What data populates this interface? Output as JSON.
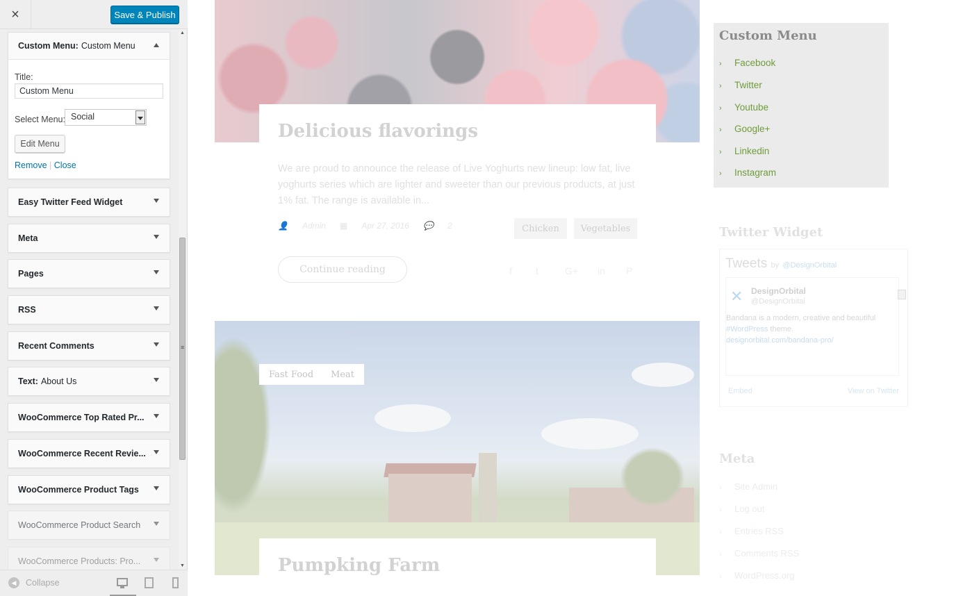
{
  "sidebar": {
    "close_label": "×",
    "publish_label": "Save & Publish",
    "custom_menu": {
      "header_bold": "Custom Menu:",
      "header_sub": "Custom Menu",
      "title_label": "Title:",
      "title_value": "Custom Menu",
      "select_label": "Select Menu:",
      "select_value": "Social",
      "edit_button": "Edit Menu",
      "remove_link": "Remove",
      "separator": "|",
      "close_link": "Close"
    },
    "widgets": [
      {
        "bold": "Easy Twitter Feed Widget",
        "sub": ""
      },
      {
        "bold": "Meta",
        "sub": ""
      },
      {
        "bold": "Pages",
        "sub": ""
      },
      {
        "bold": "RSS",
        "sub": ""
      },
      {
        "bold": "Recent Comments",
        "sub": ""
      },
      {
        "bold": "Text:",
        "sub": "About Us"
      },
      {
        "bold": "WooCommerce Top Rated Pr...",
        "sub": ""
      },
      {
        "bold": "WooCommerce Recent Revie...",
        "sub": ""
      },
      {
        "bold": "WooCommerce Product Tags",
        "sub": ""
      },
      {
        "bold": "WooCommerce Product Search",
        "sub": ""
      },
      {
        "bold": "WooCommerce Products: Pro...",
        "sub": ""
      }
    ],
    "footer": {
      "collapse_label": "Collapse"
    }
  },
  "preview": {
    "post1": {
      "title": "Delicious flavorings",
      "excerpt": "We are proud to announce the release of Live Yoghurts new lineup: low fat, live yoghurts series which are lighter and sweeter than our previous products, at just 1% fat. The range is available in...",
      "author": "Admin",
      "date": "Apr 27, 2016",
      "comments": "2",
      "tags": [
        "Chicken",
        "Vegetables"
      ],
      "continue_label": "Continue reading"
    },
    "post2": {
      "tags": [
        "Fast Food",
        "Meat"
      ],
      "title": "Pumpking Farm"
    },
    "custom_menu_widget": {
      "title": "Custom Menu",
      "items": [
        "Facebook",
        "Twitter",
        "Youtube",
        "Google+",
        "Linkedin",
        "Instagram"
      ]
    },
    "twitter_widget": {
      "title": "Twitter Widget",
      "tweets_label": "Tweets",
      "by_label": "by",
      "by_handle": "@DesignOrbital",
      "name": "DesignOrbital",
      "handle": "@DesignOrbital",
      "text_1": "Bandana is a modern, creative and beautiful",
      "hashtag": "#WordPress",
      "text_2": "theme.",
      "link": "designorbital.com/bandana-pro/",
      "embed_label": "Embed",
      "view_label": "View on Twitter"
    },
    "meta_widget": {
      "title": "Meta",
      "items": [
        "Site Admin",
        "Log out",
        "Entries RSS",
        "Comments RSS",
        "WordPress.org"
      ]
    }
  }
}
